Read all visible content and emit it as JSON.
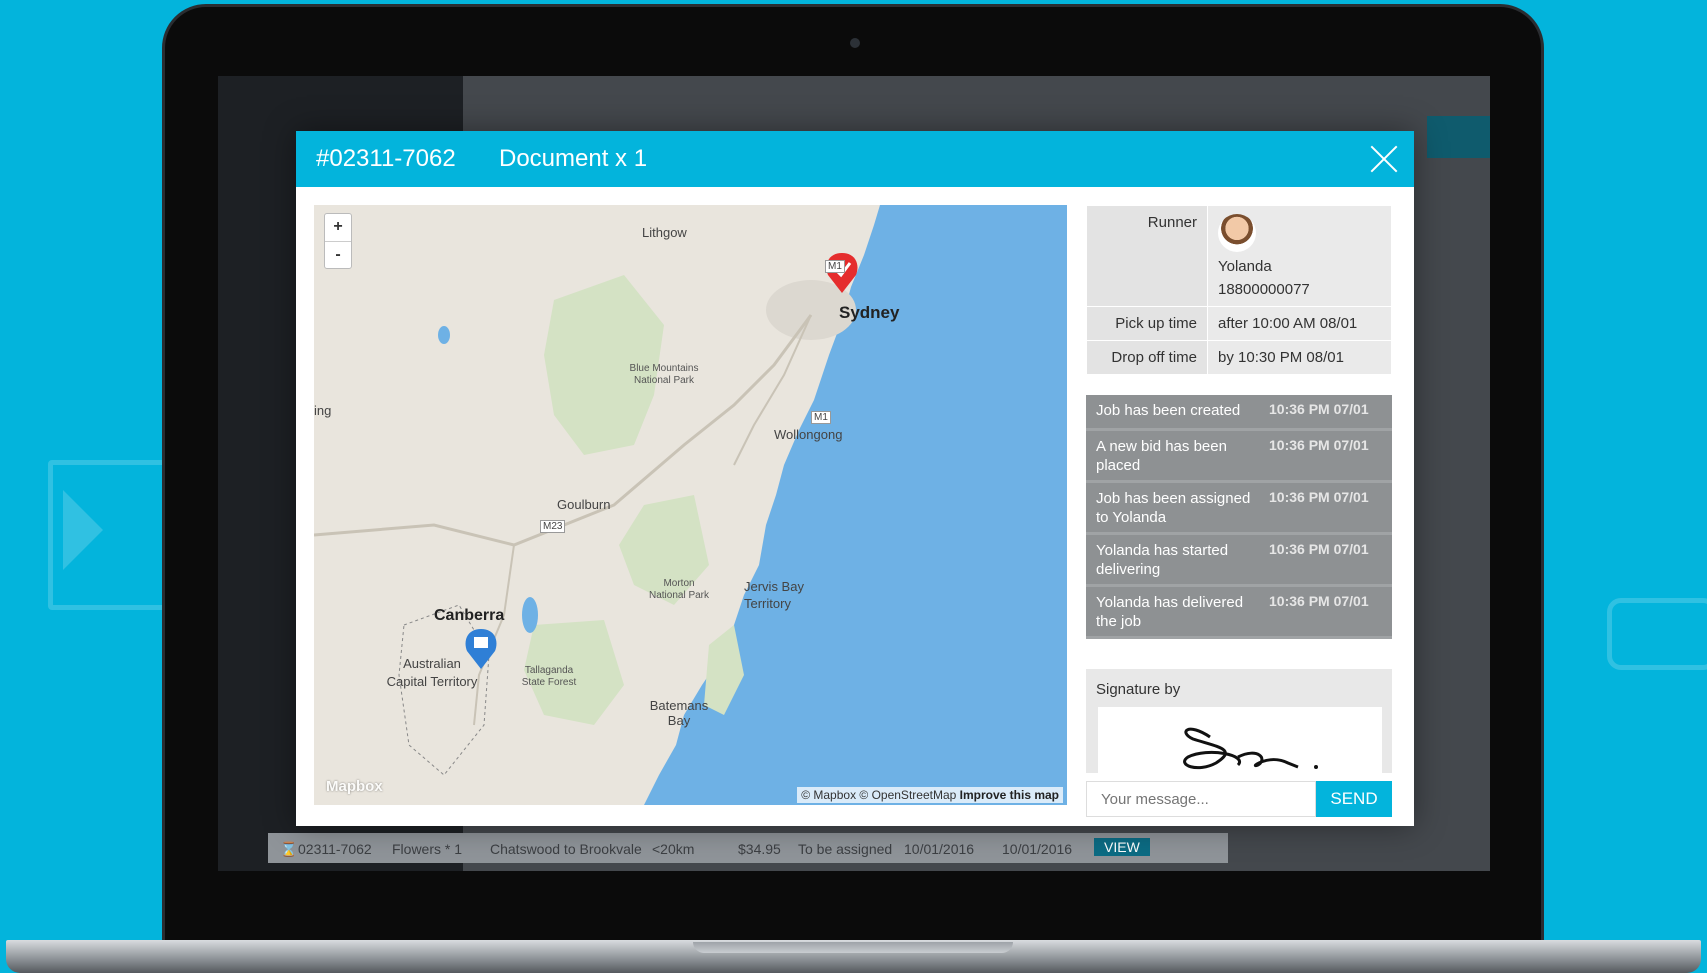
{
  "modal": {
    "job_id": "#02311-7062",
    "title": "Document x 1"
  },
  "map": {
    "zoom_in": "+",
    "zoom_out": "-",
    "labels": {
      "lithgow": "Lithgow",
      "sydney": "Sydney",
      "blue_mountains": "Blue Mountains National Park",
      "wollongong": "Wollongong",
      "goulburn": "Goulburn",
      "morton": "Morton National Park",
      "jervis": "Jervis Bay Territory",
      "canberra": "Canberra",
      "act": "Australian Capital Territory",
      "tallaganda": "Tallaganda State Forest",
      "batemans": "Batemans Bay",
      "left_edge": "ing",
      "m1a": "M1",
      "m1b": "M1",
      "m23": "M23"
    },
    "attribution_prefix": "© Mapbox © OpenStreetMap",
    "attribution_link": "Improve this map",
    "logo": "Mapbox"
  },
  "details": {
    "runner_label": "Runner",
    "runner_name": "Yolanda",
    "runner_phone": "18800000077",
    "pickup_label": "Pick up time",
    "pickup_value": "after 10:00 AM 08/01",
    "dropoff_label": "Drop off time",
    "dropoff_value": "by 10:30 PM 08/01"
  },
  "timeline": [
    {
      "message": "Job has been created",
      "time": "10:36 PM 07/01"
    },
    {
      "message": "A new bid has been placed",
      "time": "10:36 PM 07/01"
    },
    {
      "message": "Job has been assigned to Yolanda",
      "time": "10:36 PM 07/01"
    },
    {
      "message": "Yolanda has started delivering",
      "time": "10:36 PM 07/01"
    },
    {
      "message": "Yolanda has delivered the job",
      "time": "10:36 PM 07/01"
    }
  ],
  "signature": {
    "label": "Signature by"
  },
  "message": {
    "placeholder": "Your message...",
    "send_label": "SEND"
  },
  "background_row": {
    "id": "02311-7062",
    "item": "Flowers * 1",
    "route": "Chatswood to Brookvale",
    "distance": "<20km",
    "price": "$34.95",
    "status": "To be assigned",
    "date1": "10/01/2016",
    "date2": "10/01/2016",
    "view": "VIEW"
  },
  "colors": {
    "accent": "#03b4dc",
    "timeline_bg": "#8e9193",
    "cancel": "#b11d2a"
  }
}
